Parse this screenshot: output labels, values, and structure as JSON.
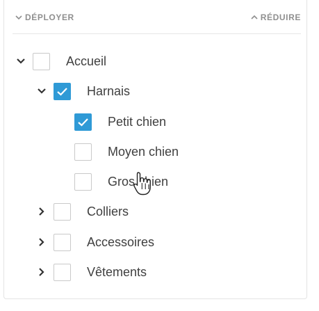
{
  "header": {
    "expand_label": "DÉPLOYER",
    "collapse_label": "RÉDUIRE"
  },
  "tree": {
    "accueil": {
      "label": "Accueil",
      "checked": false,
      "expanded": true
    },
    "harnais": {
      "label": "Harnais",
      "checked": true,
      "expanded": true
    },
    "petit_chien": {
      "label": "Petit chien",
      "checked": true
    },
    "moyen_chien": {
      "label": "Moyen chien",
      "checked": false
    },
    "gros_chien": {
      "label": "Gros chien",
      "checked": false
    },
    "colliers": {
      "label": "Colliers",
      "checked": false,
      "expanded": false
    },
    "accessoires": {
      "label": "Accessoires",
      "checked": false,
      "expanded": false
    },
    "vetements": {
      "label": "Vêtements",
      "checked": false,
      "expanded": false
    }
  },
  "colors": {
    "accent": "#2f9ad6",
    "text": "#3f3f3f",
    "header_text": "#8f8f8f",
    "border": "#c9c9c9"
  },
  "icons": {
    "expand": "chevron-down-icon",
    "collapse": "chevron-up-icon",
    "check": "check-icon",
    "pointer": "hand-pointer-icon"
  }
}
